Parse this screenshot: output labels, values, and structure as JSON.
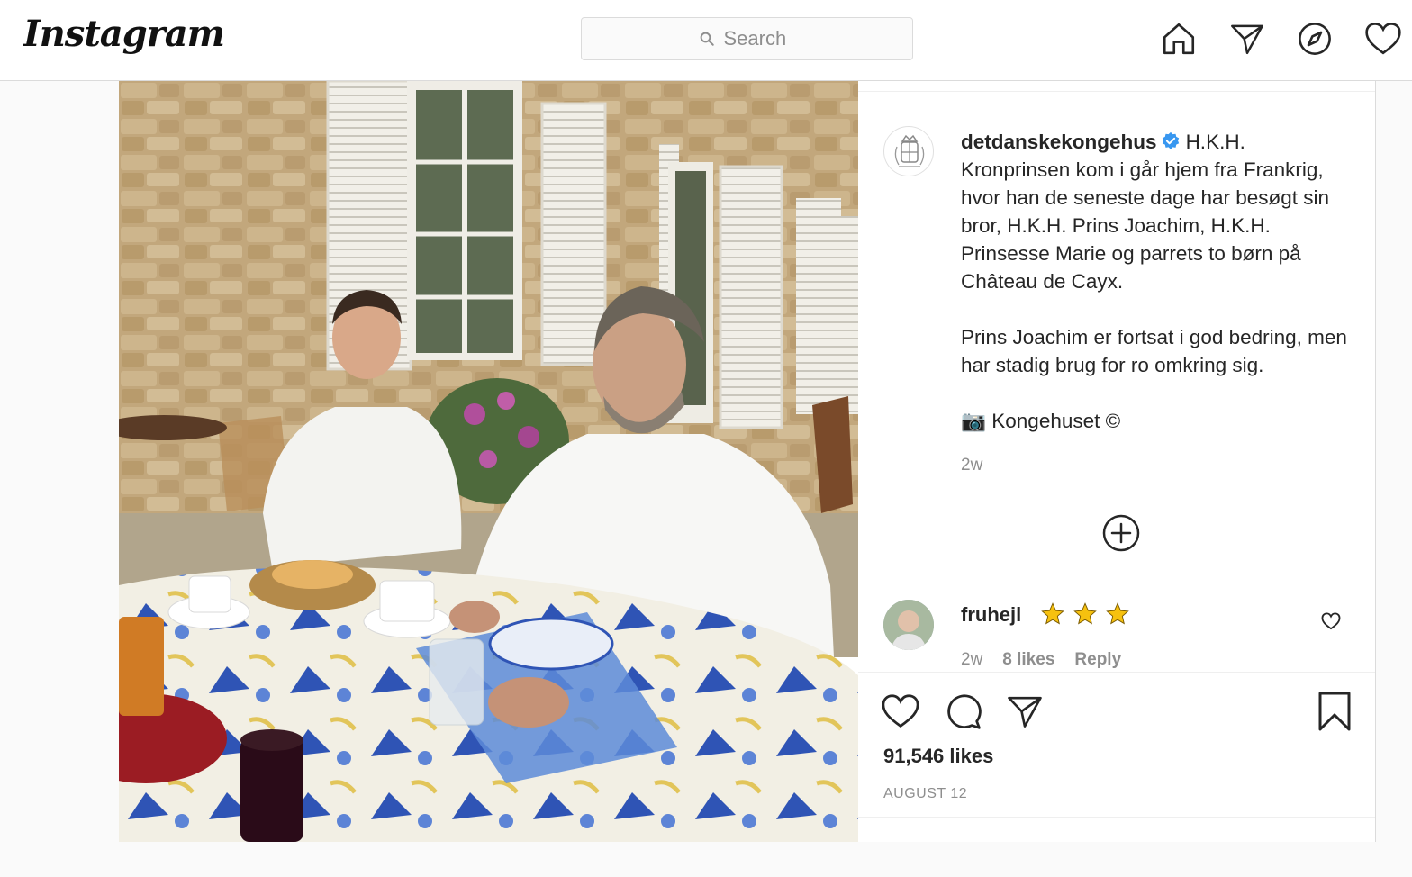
{
  "nav": {
    "logo": "Instagram",
    "search_placeholder": "Search",
    "icons": [
      "home-icon",
      "direct-icon",
      "explore-icon",
      "activity-heart-icon"
    ]
  },
  "post": {
    "image_alt": "Two men sitting at a breakfast table outside a stone house with white shutters",
    "author": "detdanskekongehus",
    "verified": true,
    "caption_lines": [
      "H.K.H. Kronprinsen kom i går hjem fra Frankrig, hvor han de seneste dage har besøgt sin bror, H.K.H. Prins Joachim, H.K.H. Prinsesse Marie og parrets to børn på Château de Cayx.",
      "Prins Joachim er fortsat i god bedring, men har stadig brug for ro omkring sig.",
      "📷 Kongehuset ©"
    ],
    "caption_age": "2w",
    "comment": {
      "user": "fruhejl",
      "text": "⭐⭐⭐",
      "age": "2w",
      "likes": "8 likes",
      "reply": "Reply"
    },
    "likes": "91,546 likes",
    "date": "AUGUST 12"
  },
  "colors": {
    "text": "#262626",
    "muted": "#8e8e8e",
    "border": "#dbdbdb",
    "verified_blue": "#3897f0"
  }
}
